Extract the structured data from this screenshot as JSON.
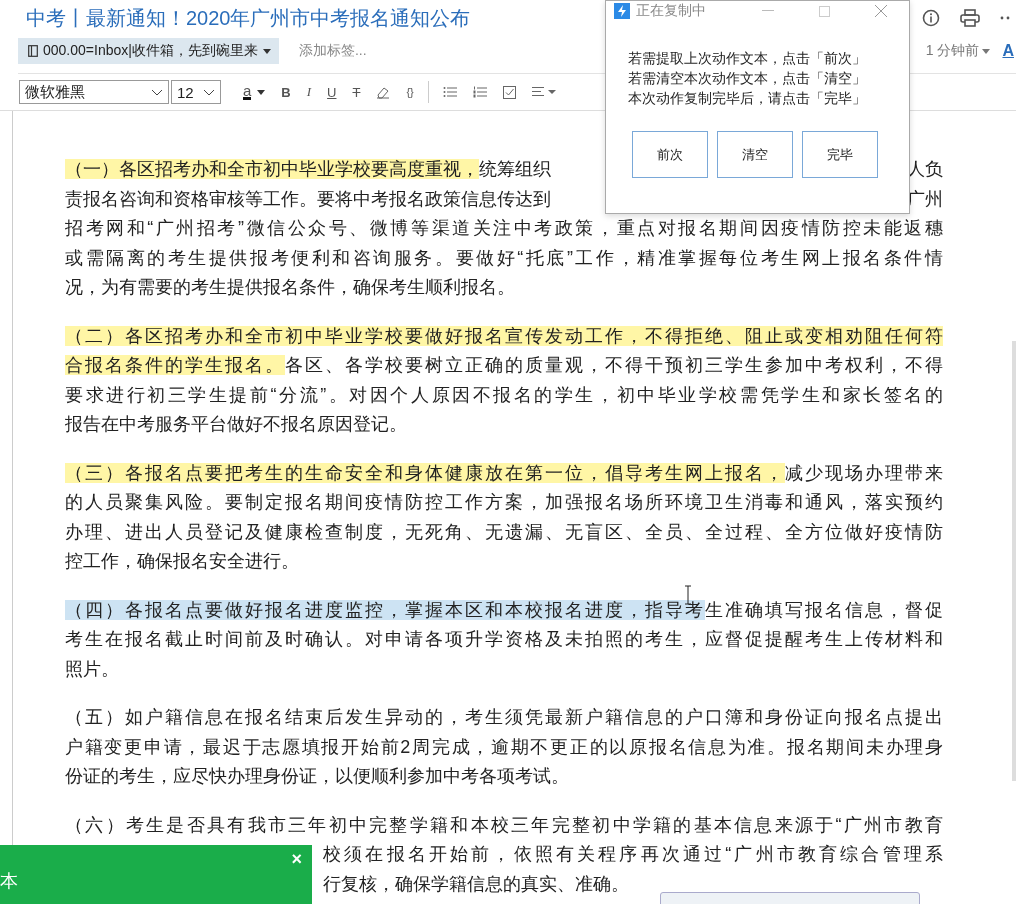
{
  "document": {
    "title": "中考丨最新通知！2020年广州市中考报名通知公布",
    "folder_chip": "000.00=Inbox|收件箱，先到碗里来",
    "tag_placeholder": "添加标签...",
    "time": "1 分钟前",
    "cut_link": "A"
  },
  "toolbar": {
    "font": "微软雅黑",
    "size": "12",
    "buttons": [
      {
        "kind": "color",
        "label": "a"
      },
      {
        "kind": "bold",
        "label": "B"
      },
      {
        "kind": "italic",
        "label": "I"
      },
      {
        "kind": "underline",
        "label": "U"
      },
      {
        "kind": "strike",
        "label": "T"
      },
      {
        "kind": "eraser"
      },
      {
        "kind": "code",
        "label": "{}"
      },
      {
        "kind": "divider"
      },
      {
        "kind": "bullets"
      },
      {
        "kind": "numbers"
      },
      {
        "kind": "checklist"
      },
      {
        "kind": "align"
      }
    ]
  },
  "paragraphs": [
    {
      "lines": [
        {
          "left": [
            {
              "text": "（一）各区招考办和全市初中毕业学校要高度重视，",
              "marked": true,
              "selected": false
            },
            {
              "text": "统筹组织",
              "marked": false,
              "selected": false
            }
          ],
          "right": [
            {
              "text": "人负",
              "marked": false,
              "selected": false
            }
          ]
        },
        {
          "left": [
            {
              "text": "责报名咨询和资格审核等工作。要将中考报名政策信息传达到",
              "marked": false,
              "selected": false
            }
          ],
          "right": [
            {
              "text": "广州",
              "marked": false,
              "selected": false
            }
          ]
        },
        {
          "left": [
            {
              "text": "招考网和“广州招考”微信公众号、微博等渠道关注中考政策，重点对报名期间因疫情防控未能返穗",
              "marked": false,
              "selected": false
            }
          ]
        },
        {
          "left": [
            {
              "text": "或需隔离的考生提供报考便利和咨询服务。要做好“托底”工作，精准掌握每位考生网上报名条件情",
              "marked": false,
              "selected": false
            }
          ]
        },
        {
          "left": [
            {
              "text": "况，为有需要的考生提供报名条件，确保考生顺利报名。",
              "marked": false,
              "selected": false
            }
          ]
        }
      ]
    },
    {
      "lines": [
        {
          "left": [
            {
              "text": "（二）各区招考办和全市初中毕业学校要做好报名宣传发动工作，不得拒绝、阻止或变相劝阻任何符",
              "marked": true,
              "selected": false
            }
          ]
        },
        {
          "left": [
            {
              "text": "合报名条件的学生报名。",
              "marked": true,
              "selected": false
            },
            {
              "text": "各区、各学校要树立正确的质量观，不得干预初三学生参加中考权利，不得",
              "marked": false,
              "selected": false
            }
          ]
        },
        {
          "left": [
            {
              "text": "要求进行初三学生提前“分流”。对因个人原因不报名的学生，初中毕业学校需凭学生和家长签名的",
              "marked": false,
              "selected": false
            }
          ]
        },
        {
          "left": [
            {
              "text": "报告在中考服务平台做好不报名原因登记。",
              "marked": false,
              "selected": false
            }
          ]
        }
      ]
    },
    {
      "lines": [
        {
          "left": [
            {
              "text": "（三）各报名点要把考生的生命安全和身体健康放在第一位，倡导考生网上报名，",
              "marked": true,
              "selected": false
            },
            {
              "text": "减少现场办理带来",
              "marked": false,
              "selected": false
            }
          ]
        },
        {
          "left": [
            {
              "text": "的人员聚集风险。要制定报名期间疫情防控工作方案，加强报名场所环境卫生消毒和通风，落实预约",
              "marked": false,
              "selected": false
            }
          ]
        },
        {
          "left": [
            {
              "text": "办理、进出人员登记及健康检查制度，无死角、无遗漏、无盲区、全员、全过程、全方位做好疫情防",
              "marked": false,
              "selected": false
            }
          ]
        },
        {
          "left": [
            {
              "text": "控工作，确保报名安全进行。",
              "marked": false,
              "selected": false
            }
          ]
        }
      ]
    },
    {
      "lines": [
        {
          "left": [
            {
              "text": "（四）各报名点要做好报名进度监控，掌握本区和本校报名进度，指导考",
              "marked": false,
              "selected": true
            },
            {
              "text": "生准确填写报名信息，督促",
              "marked": false,
              "selected": false
            }
          ]
        },
        {
          "left": [
            {
              "text": "考生在报名截止时间前及时确认。对申请各项升学资格及未拍照的考生，应督促提醒考生上传材料和",
              "marked": false,
              "selected": false
            }
          ]
        },
        {
          "left": [
            {
              "text": "照片。",
              "marked": false,
              "selected": false
            }
          ]
        }
      ]
    },
    {
      "lines": [
        {
          "left": [
            {
              "text": "（五）如户籍信息在报名结束后发生异动的，考生须凭最新户籍信息的户口簿和身份证向报名点提出",
              "marked": false,
              "selected": false
            }
          ]
        },
        {
          "left": [
            {
              "text": "户籍变更申请，最迟于志愿填报开始前2周完成，逾期不更正的以原报名信息为准。报名期间未办理身",
              "marked": false,
              "selected": false
            }
          ]
        },
        {
          "left": [
            {
              "text": "份证的考生，应尽快办理身份证，以便顺利参加中考各项考试。",
              "marked": false,
              "selected": false
            }
          ]
        }
      ]
    },
    {
      "lines": [
        {
          "left": [
            {
              "text": "（六）考生是否具有我市三年初中完整学籍和本校三年完整初中学籍的基本信息来源于“广州市教育",
              "marked": false,
              "selected": false
            }
          ]
        },
        {
          "under_toast": [
            {
              "text": "校须在报名开始前，依照有关程序再次通过“广州市教育综合管理系",
              "marked": false,
              "selected": false
            }
          ]
        },
        {
          "under_toast": [
            {
              "text": "行复核，确保学籍信息的真实、准确。",
              "marked": false,
              "selected": false
            }
          ]
        }
      ]
    }
  ],
  "popup": {
    "title": "正在复制中",
    "lines": [
      "若需提取上次动作文本，点击「前次」",
      "若需清空本次动作文本，点击「清空」",
      "本次动作复制完毕后，请点击「完毕」"
    ],
    "buttons": [
      "前次",
      "清空",
      "完毕"
    ]
  },
  "toast": {
    "text": "本",
    "close": "×"
  }
}
